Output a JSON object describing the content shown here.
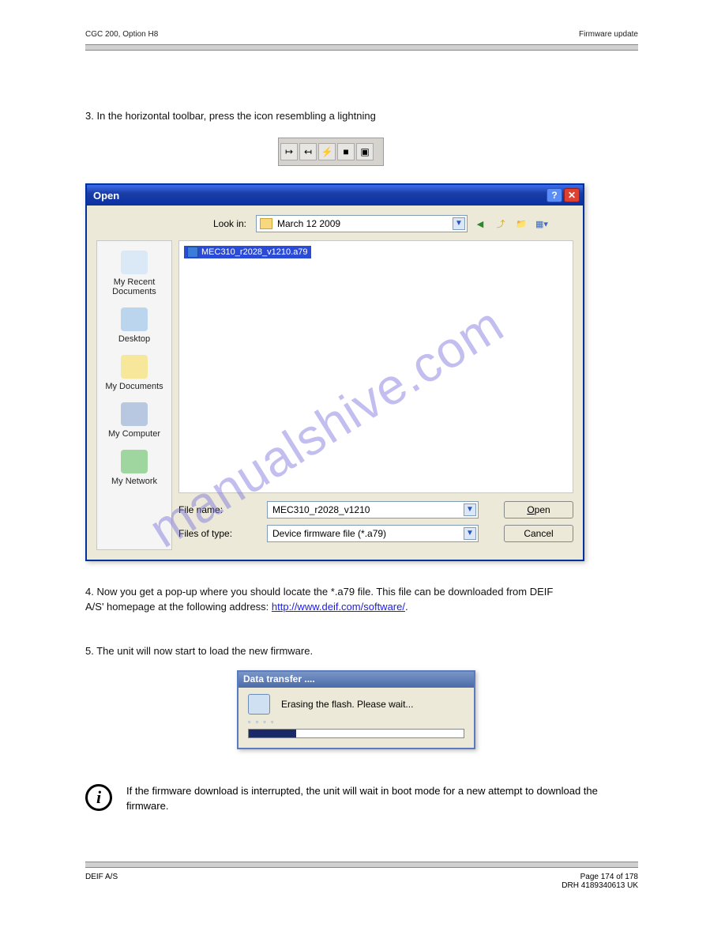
{
  "header": {
    "left": "CGC 200, Option H8",
    "right": "Firmware update"
  },
  "watermark": "manualshive.com",
  "step3": "3.   In the horizontal toolbar, press the icon resembling a lightning",
  "toolbar": {
    "btns": [
      "↦",
      "↤",
      "⚡",
      "■",
      "▣"
    ]
  },
  "dialog": {
    "title": "Open",
    "lookin_label": "Look in:",
    "lookin_value": "March 12 2009",
    "file_item": "MEC310_r2028_v1210.a79",
    "places": [
      {
        "label": "My Recent Documents",
        "color": "#dbe8f5"
      },
      {
        "label": "Desktop",
        "color": "#bcd5ef"
      },
      {
        "label": "My Documents",
        "color": "#f6e79a"
      },
      {
        "label": "My Computer",
        "color": "#b8c8e0"
      },
      {
        "label": "My Network",
        "color": "#9fd69f"
      }
    ],
    "file_name_label": "File name:",
    "file_name_value": "MEC310_r2028_v1210",
    "files_of_type_label": "Files of type:",
    "files_of_type_value": "Device firmware file (*.a79)",
    "open_btn": "Open",
    "cancel_btn": "Cancel"
  },
  "step4_a": "4.   Now you get a pop-up where you should locate the *.a79 file. This file can be downloaded from DEIF",
  "step4_b": "     A/S' homepage at the following address: ",
  "step4_link": "http://www.deif.com/software/",
  "step4_c": ".",
  "step5": "5.   The unit will now start to load the new firmware.",
  "data_transfer": {
    "title": "Data transfer ....",
    "msg": "Erasing the flash. Please wait...",
    "dots": "▫ ▫ ▫ ▫"
  },
  "info": "If the firmware download is interrupted, the unit will wait in boot mode for a new attempt to download the firmware.",
  "footer": {
    "left": "DEIF A/S",
    "right_top": "Page 174 of 178",
    "right_bottom": "DRH 4189340613 UK"
  }
}
